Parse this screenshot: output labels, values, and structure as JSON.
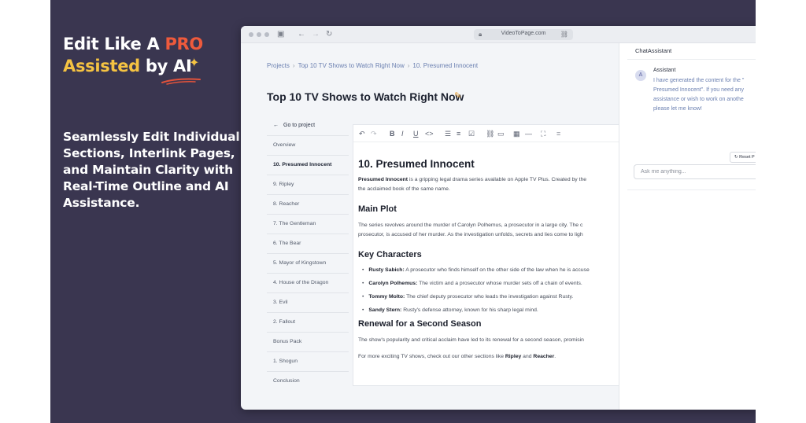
{
  "promo": {
    "line1_white": "Edit Like A ",
    "line1_accent": "PRO",
    "line2_accent": "Assisted ",
    "line2_white": "by AI",
    "tagline": "Seamlessly Edit Individual Sections, Interlink Pages, and Maintain Clarity with Real-Time Outline and AI Assistance."
  },
  "browser": {
    "url": "VideoToPage.com"
  },
  "breadcrumb": [
    "Projects",
    "Top 10 TV Shows to Watch Right Now",
    "10. Presumed Innocent"
  ],
  "page_title": "Top 10 TV Shows to Watch Right Now",
  "outline": {
    "back_label": "Go to project",
    "items": [
      "Overview",
      "10. Presumed Innocent",
      "9. Ripley",
      "8. Reacher",
      "7. The Gentleman",
      "6. The Bear",
      "5. Mayor of Kingstown",
      "4. House of the Dragon",
      "3. Evil",
      "2. Fallout",
      "Bonus Pack",
      "1. Shogun",
      "Conclusion"
    ],
    "active_index": 1
  },
  "editor": {
    "heading": "10. Presumed Innocent",
    "intro_bold": "Presumed Innocent",
    "intro_rest": " is a gripping legal drama series available on Apple TV Plus. Created by the",
    "intro_line2": "the acclaimed book of the same name.",
    "main_plot_heading": "Main Plot",
    "main_plot_line1": "The series revolves around the murder of Carolyn Polhemus, a prosecutor in a large city. The c",
    "main_plot_line2": "prosecutor, is accused of her murder. As the investigation unfolds, secrets and lies come to ligh",
    "key_characters_heading": "Key Characters",
    "characters": [
      {
        "name": "Rusty Sabich:",
        "desc": " A prosecutor who finds himself on the other side of the law when he is accuse"
      },
      {
        "name": "Carolyn Polhemus:",
        "desc": " The victim and a prosecutor whose murder sets off a chain of events."
      },
      {
        "name": "Tommy Molto:",
        "desc": " The chief deputy prosecutor who leads the investigation against Rusty."
      },
      {
        "name": "Sandy Stern:",
        "desc": " Rusty's defense attorney, known for his sharp legal mind."
      }
    ],
    "renewal_heading": "Renewal for a Second Season",
    "renewal_line": "The show's popularity and critical acclaim have led to its renewal for a second season, promisin",
    "more_prefix": "For more exciting TV shows, check out our other sections like ",
    "more_link1": "Ripley",
    "more_and": " and ",
    "more_link2": "Reacher",
    "more_suffix": "."
  },
  "chat": {
    "title": "ChatAssistant",
    "avatar_letter": "A",
    "assistant_name": "Assistant",
    "message_lines": [
      "I have generated the content for the \"",
      "Presumed Innocent\". If you need any",
      "assistance or wish to work on anothe",
      "please let me know!"
    ],
    "reset_label": "Reset P",
    "input_placeholder": "Ask me anything..."
  }
}
